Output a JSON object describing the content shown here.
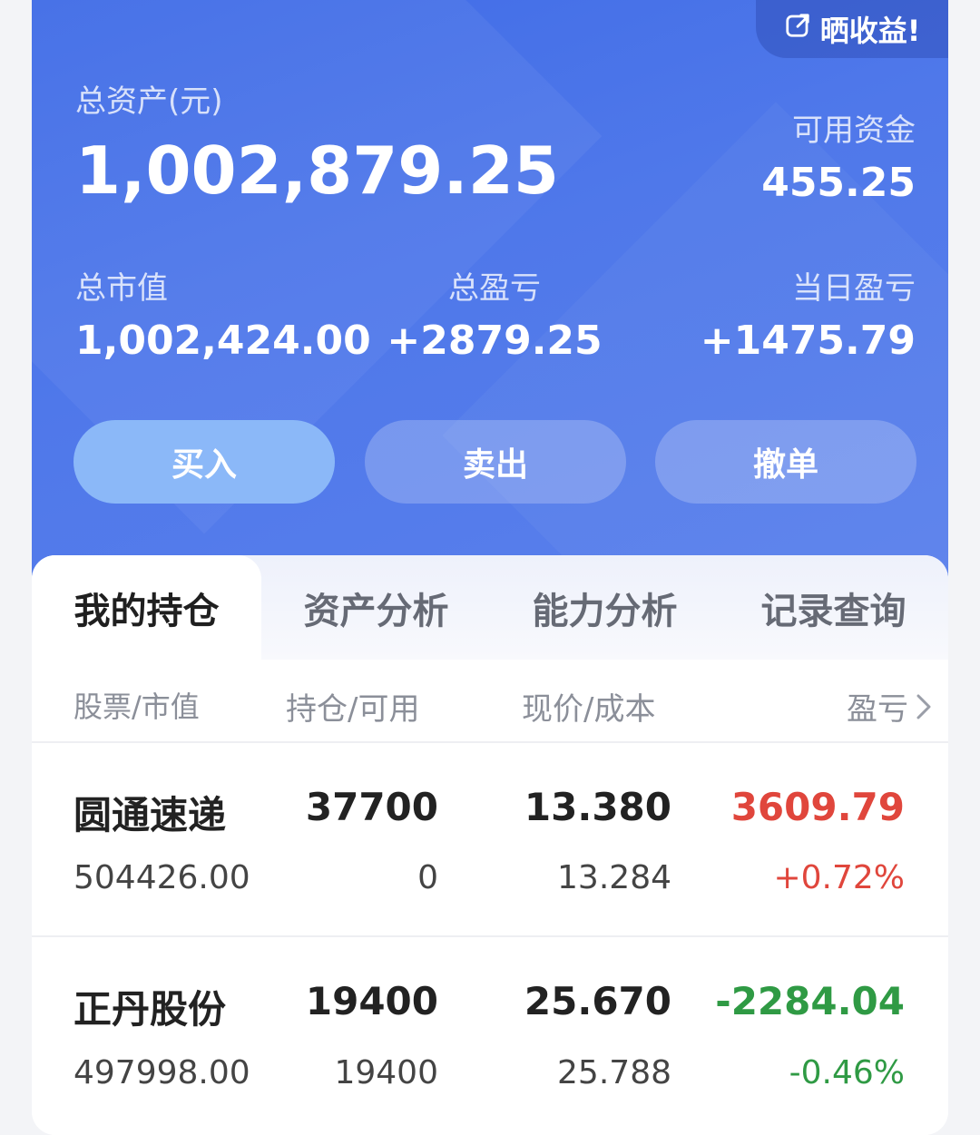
{
  "summary": {
    "share_label": "晒收益!",
    "total_assets_label": "总资产(元)",
    "total_assets_value": "1,002,879.25",
    "available_funds_label": "可用资金",
    "available_funds_value": "455.25",
    "market_value_label": "总市值",
    "market_value_value": "1,002,424.00",
    "total_pnl_label": "总盈亏",
    "total_pnl_value": "+2879.25",
    "daily_pnl_label": "当日盈亏",
    "daily_pnl_value": "+1475.79"
  },
  "actions": {
    "buy_label": "买入",
    "sell_label": "卖出",
    "cancel_label": "撤单"
  },
  "tabs": [
    {
      "label": "我的持仓"
    },
    {
      "label": "资产分析"
    },
    {
      "label": "能力分析"
    },
    {
      "label": "记录查询"
    }
  ],
  "table": {
    "headers": {
      "stock": "股票/市值",
      "position": "持仓/可用",
      "price": "现价/成本",
      "pnl": "盈亏"
    },
    "rows": [
      {
        "name": "圆通速递",
        "market_value": "504426.00",
        "position": "37700",
        "available": "0",
        "price": "13.380",
        "cost": "13.284",
        "pnl": "3609.79",
        "pnl_pct": "+0.72%",
        "pnl_color": "#e0463c"
      },
      {
        "name": "正丹股份",
        "market_value": "497998.00",
        "position": "19400",
        "available": "19400",
        "price": "25.670",
        "cost": "25.788",
        "pnl": "-2284.04",
        "pnl_pct": "-0.46%",
        "pnl_color": "#2f9a44"
      }
    ]
  },
  "colors": {
    "hero_blue": "#4a73e8",
    "profit_red": "#e0463c",
    "loss_green": "#2f9a44"
  }
}
